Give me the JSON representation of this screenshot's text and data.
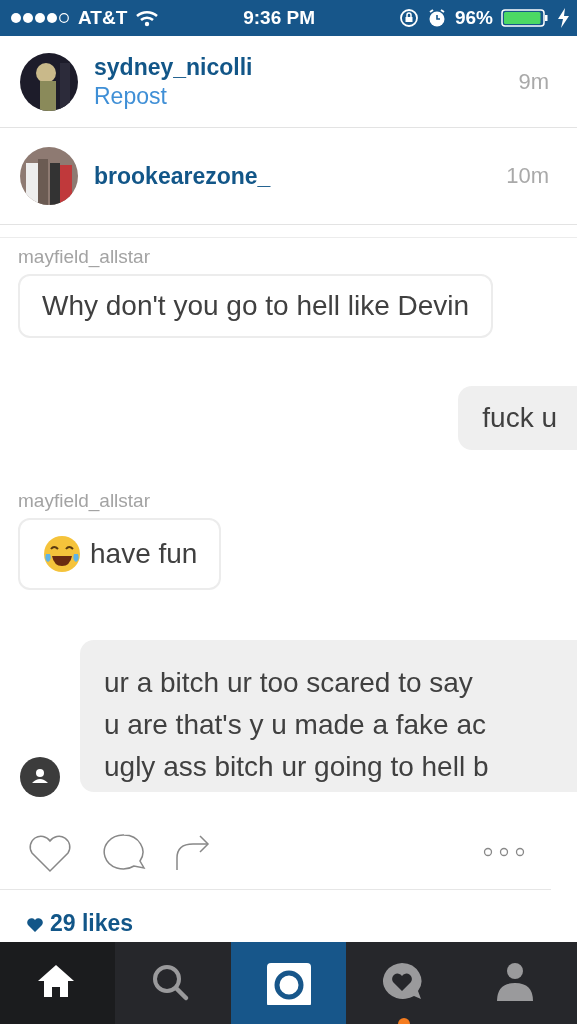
{
  "status_bar": {
    "carrier": "AT&T",
    "time": "9:36 PM",
    "battery": "96%"
  },
  "posts": [
    {
      "username": "sydney_nicolli",
      "subtitle": "Repost",
      "time": "9m"
    },
    {
      "username": "brookearezone_",
      "time": "10m"
    }
  ],
  "post_image": {
    "kind": "screenshot",
    "messages": [
      {
        "kind": "received",
        "sender": "mayfield_allstar",
        "text": "Why don't you go to hell like Devin"
      },
      {
        "kind": "sent",
        "lines": [
          "fuck u"
        ]
      },
      {
        "kind": "received",
        "sender": "mayfield_allstar",
        "emoji_icon": true,
        "text": "have fun"
      },
      {
        "kind": "sent",
        "avatar": true,
        "lines": [
          "ur a bitch ur too scared to say",
          "u are that's y u made a fake ac",
          "ugly ass bitch ur going to hell b"
        ]
      }
    ]
  },
  "actions": {
    "liked": false
  },
  "likes": "29 likes",
  "tab_bar": [
    {
      "kind": "home",
      "selected": true
    },
    {
      "kind": "search",
      "selected": false
    },
    {
      "kind": "camera",
      "selected": false
    },
    {
      "kind": "activity",
      "selected": false,
      "badge": true
    },
    {
      "kind": "profile",
      "selected": false
    }
  ]
}
